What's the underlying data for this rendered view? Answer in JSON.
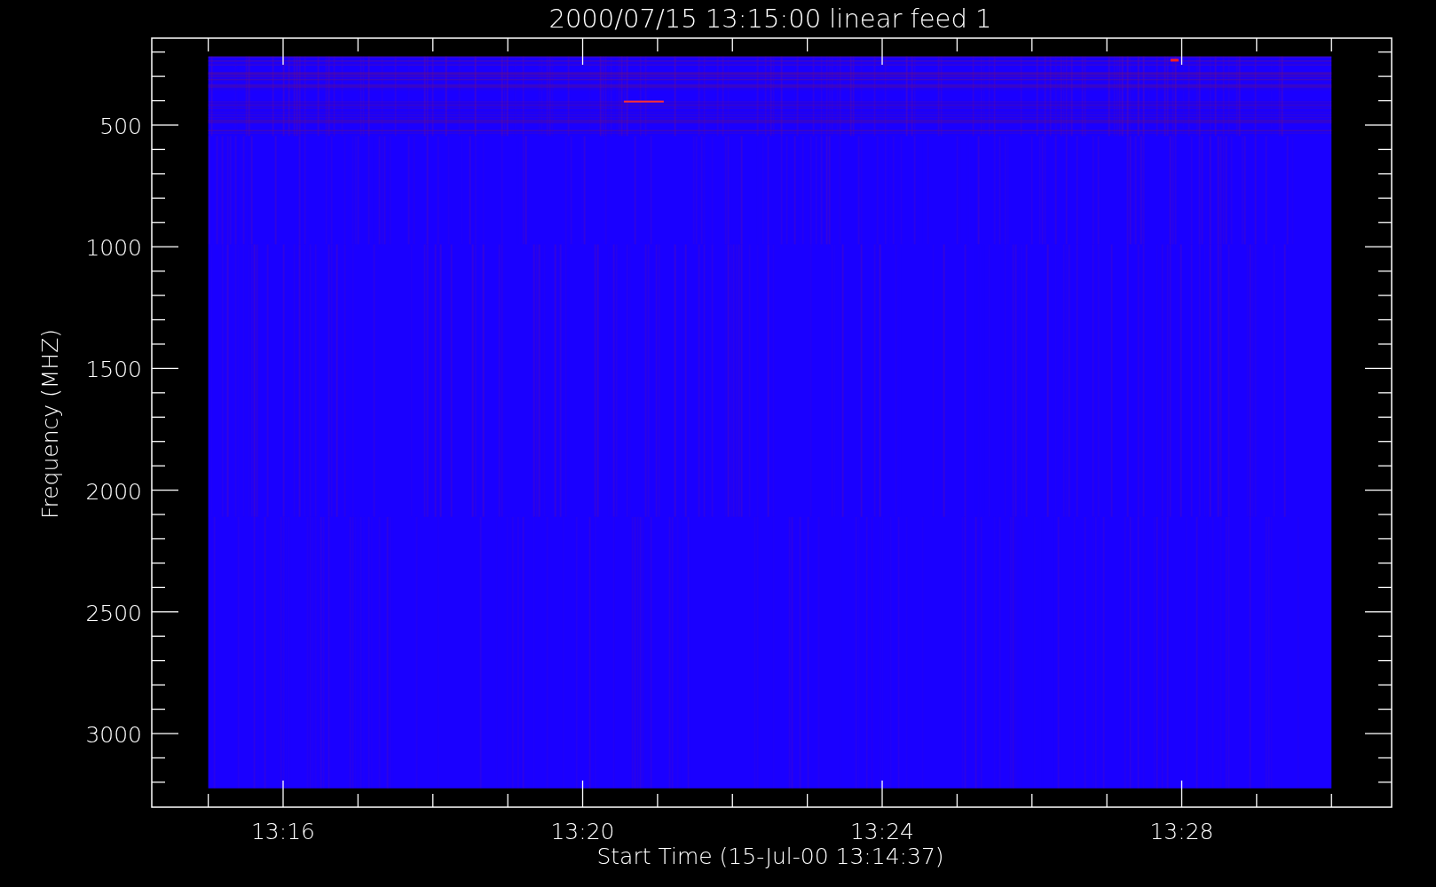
{
  "title": "2000/07/15 13:15:00 linear feed 1",
  "ylabel": "Frequency (MHZ)",
  "xlabel": "Start Time (15-Jul-00 13:14:37)",
  "yticks": [
    "500",
    "1000",
    "1500",
    "2000",
    "2500",
    "3000"
  ],
  "xticks": [
    "13:16",
    "13:20",
    "13:24",
    "13:28"
  ]
}
